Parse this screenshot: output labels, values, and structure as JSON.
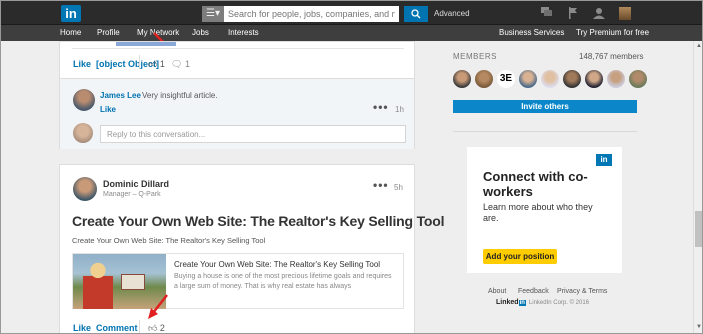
{
  "topbar": {
    "logo": "in",
    "search_placeholder": "Search for people, jobs, companies, and more...",
    "search_button_icon": "search-icon",
    "advanced": "Advanced",
    "icons": [
      "messages-icon",
      "flag-icon",
      "profile-icon",
      "avatar"
    ]
  },
  "nav": {
    "home": "Home",
    "profile": "Profile",
    "my_network": "My Network",
    "jobs": "Jobs",
    "interests": "Interests",
    "business_services": "Business Services",
    "try_premium": "Try Premium for free"
  },
  "post1": {
    "like": "Like",
    "comment": {
      "author": "James Lee",
      "text": "Very insightful article.",
      "like": "Like",
      "time": "1h"
    },
    "likes_count": "1",
    "comments_count": "1",
    "reply_placeholder": "Reply to this conversation..."
  },
  "post2": {
    "author": "Dominic Dillard",
    "subtitle": "Manager – Q-Park",
    "time": "5h",
    "title": "Create Your Own Web Site: The Realtor's Key Selling Tool",
    "summary": "Create Your Own Web Site: The Realtor's Key Selling Tool",
    "link_title": "Create Your Own Web Site: The Realtor's Key Selling Tool",
    "link_text": "Buying a house is one of the most precious lifetime goals and requires a large sum of money. That is why real estate has always",
    "like": "Like",
    "comment": "Comment",
    "likes_count": "2"
  },
  "members": {
    "title": "MEMBERS",
    "count": "148,767 members",
    "invite": "Invite others"
  },
  "ad": {
    "logo": "in",
    "headline": "Connect with co-workers",
    "body": "Learn more about who they are.",
    "button": "Add your position"
  },
  "footer": {
    "about": "About",
    "feedback": "Feedback",
    "privacy": "Privacy & Terms",
    "brand": "Linked",
    "brand_in": "in",
    "copyright": "LinkedIn Corp. © 2016"
  },
  "colors": {
    "linkedin_blue": "#0077b5",
    "arrow_red": "#e02020",
    "ad_button": "#ffcc00"
  }
}
